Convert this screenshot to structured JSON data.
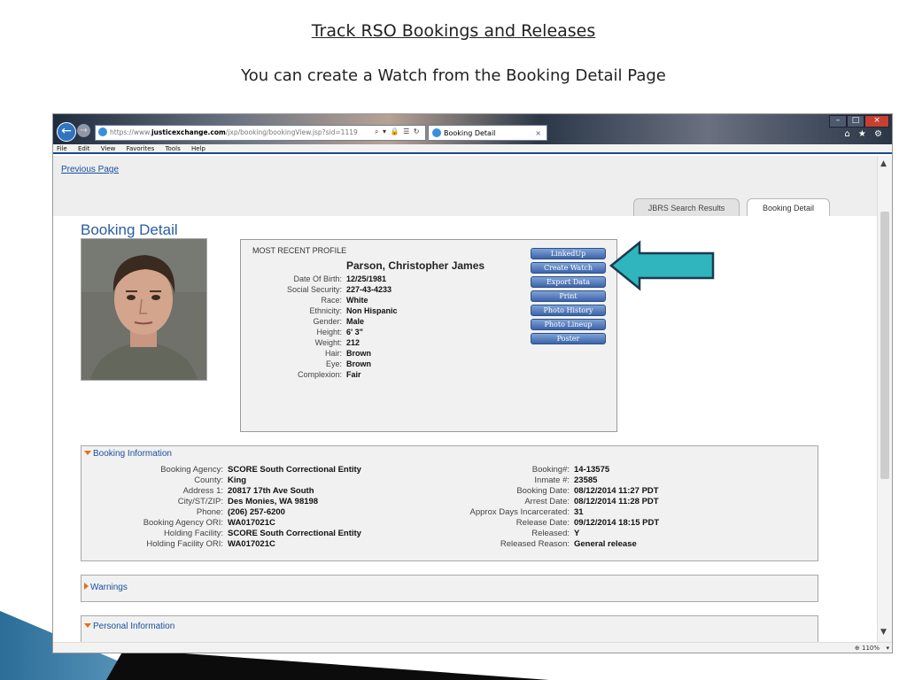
{
  "slide": {
    "title": "Track RSO Bookings and Releases",
    "subtitle": "You can create a Watch from the Booking Detail Page"
  },
  "browser": {
    "url_scheme": "https://www.",
    "url_host": "justicexchange.com",
    "url_path": "/jxp/booking/bookingView.jsp?sid=1119",
    "url_controls": "⌕ ▾ 🔒 ☰ ↻",
    "tab_title": "Booking Detail",
    "tab_close": "×",
    "menu": [
      "File",
      "Edit",
      "View",
      "Favorites",
      "Tools",
      "Help"
    ],
    "zoom": "110%",
    "window_buttons": {
      "minimize": "–",
      "maximize": "□",
      "close": "×"
    },
    "toolbar_icons": "⌂ ★ ⚙"
  },
  "page": {
    "previous_link": "Previous Page",
    "tabs": {
      "search": "JBRS Search Results",
      "detail": "Booking Detail"
    },
    "title": "Booking Detail"
  },
  "profile": {
    "heading": "MOST RECENT PROFILE",
    "name": "Parson, Christopher James",
    "fields": [
      {
        "label": "Date Of Birth:",
        "value": "12/25/1981"
      },
      {
        "label": "Social Security:",
        "value": "227-43-4233"
      },
      {
        "label": "Race:",
        "value": "White"
      },
      {
        "label": "Ethnicity:",
        "value": "Non Hispanic"
      },
      {
        "label": "Gender:",
        "value": "Male"
      },
      {
        "label": "Height:",
        "value": "6' 3\""
      },
      {
        "label": "Weight:",
        "value": "212"
      },
      {
        "label": "Hair:",
        "value": "Brown"
      },
      {
        "label": "Eye:",
        "value": "Brown"
      },
      {
        "label": "Complexion:",
        "value": "Fair"
      }
    ],
    "actions": [
      "LinkedUp",
      "Create Watch",
      "Export Data",
      "Print",
      "Photo History",
      "Photo Lineup",
      "Poster"
    ]
  },
  "booking": {
    "heading": "Booking Information",
    "left": [
      {
        "label": "Booking Agency:",
        "value": "SCORE South Correctional Entity"
      },
      {
        "label": "County:",
        "value": "King"
      },
      {
        "label": "Address 1:",
        "value": "20817 17th Ave South"
      },
      {
        "label": "City/ST/ZIP:",
        "value": "Des Monies, WA 98198"
      },
      {
        "label": "Phone:",
        "value": "(206) 257-6200"
      },
      {
        "label": "Booking Agency ORI:",
        "value": "WA017021C"
      },
      {
        "label": "Holding Facility:",
        "value": "SCORE South Correctional Entity"
      },
      {
        "label": "Holding Facility ORI:",
        "value": "WA017021C"
      }
    ],
    "right": [
      {
        "label": "Booking#:",
        "value": "14-13575"
      },
      {
        "label": "Inmate #:",
        "value": "23585"
      },
      {
        "label": "Booking Date:",
        "value": "08/12/2014 11:27 PDT"
      },
      {
        "label": "Arrest Date:",
        "value": "08/12/2014 11:28 PDT"
      },
      {
        "label": "Approx Days Incarcerated:",
        "value": "31"
      },
      {
        "label": "Release Date:",
        "value": "09/12/2014 18:15 PDT"
      },
      {
        "label": "Released:",
        "value": "Y"
      },
      {
        "label": "Released Reason:",
        "value": "General release"
      }
    ]
  },
  "warnings": {
    "heading": "Warnings"
  },
  "personal": {
    "heading": "Personal Information"
  },
  "colors": {
    "accent_arrow": "#2fb5bd",
    "link": "#1a4fa0",
    "button": "#4a73b8"
  }
}
